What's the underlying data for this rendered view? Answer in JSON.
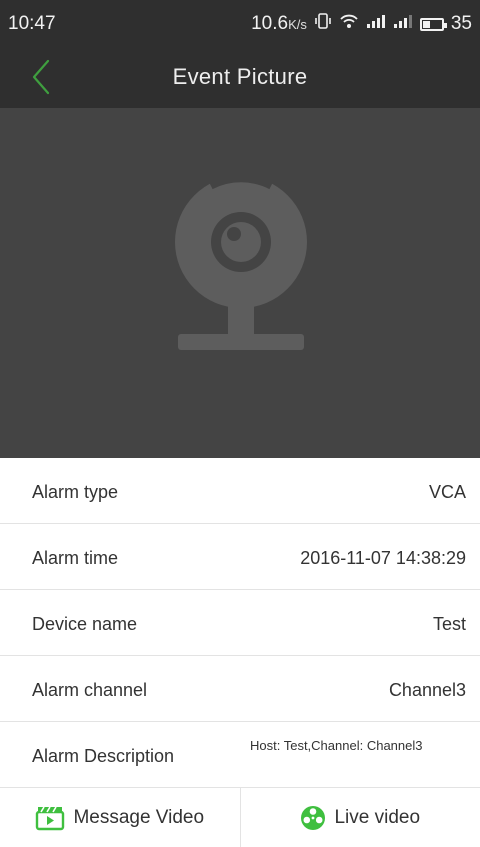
{
  "status_bar": {
    "time": "10:47",
    "speed": "10.6",
    "speed_unit": "K/s",
    "battery": "35"
  },
  "app_bar": {
    "title": "Event Picture",
    "back_icon": "chevron-left-icon"
  },
  "picture": {
    "placeholder_icon": "webcam-icon"
  },
  "info": {
    "alarm_type": {
      "label": "Alarm type",
      "value": "VCA"
    },
    "alarm_time": {
      "label": "Alarm time",
      "value": "2016-11-07 14:38:29"
    },
    "device_name": {
      "label": "Device name",
      "value": "Test"
    },
    "alarm_channel": {
      "label": "Alarm channel",
      "value": "Channel3"
    },
    "alarm_description": {
      "label": "Alarm Description",
      "value": "Host: Test,Channel: Channel3"
    }
  },
  "bottom": {
    "message_video": "Message Video",
    "live_video": "Live video"
  },
  "colors": {
    "header_bg": "#2f2f2f",
    "picture_bg": "#444444",
    "accent_green": "#3fbf3f",
    "back_green": "#3f9f3f"
  }
}
